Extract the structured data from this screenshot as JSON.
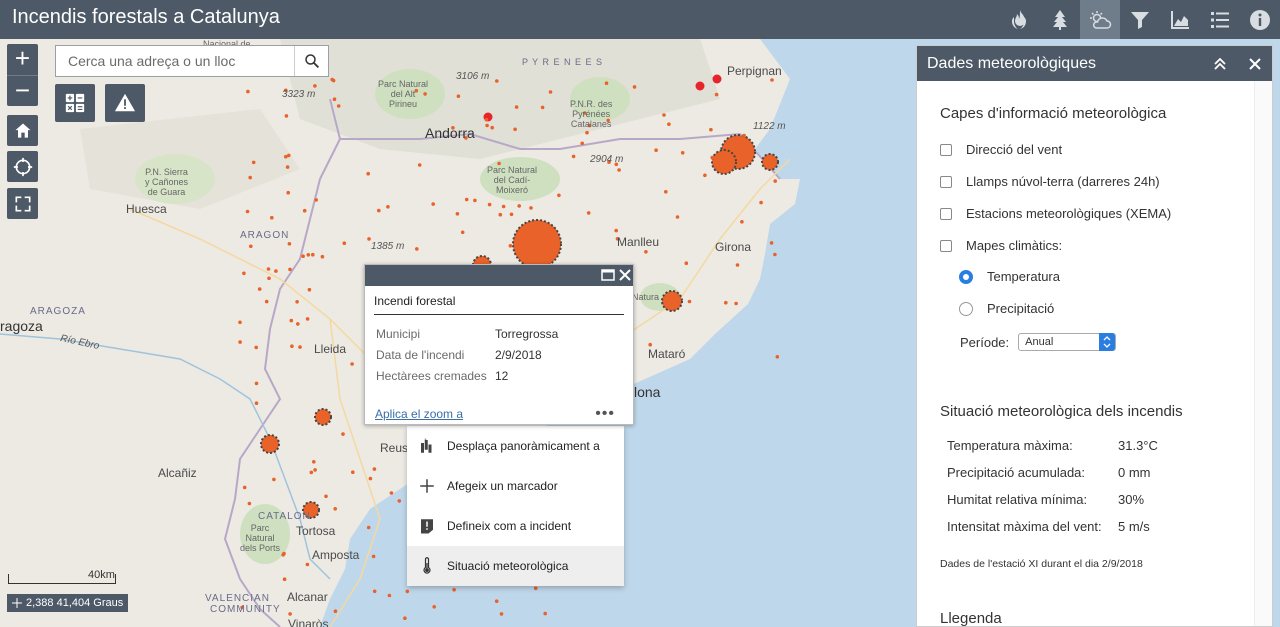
{
  "app": {
    "title": "Incendis forestals a Catalunya"
  },
  "toolbar": {
    "items": [
      {
        "icon": "fire-icon"
      },
      {
        "icon": "tree-icon"
      },
      {
        "icon": "weather-icon",
        "active": true
      },
      {
        "icon": "filter-icon"
      },
      {
        "icon": "chart-icon"
      },
      {
        "icon": "list-icon"
      },
      {
        "icon": "info-icon"
      }
    ]
  },
  "search": {
    "placeholder": "Cerca una adreça o un lloc"
  },
  "map": {
    "labels": {
      "andorra": "Andorra",
      "perpignan": "Perpignan",
      "huesca": "Huesca",
      "aragon": "ARAGON",
      "aragoza": "ragoza",
      "aragoza2": "ARAGOZA",
      "rio_ebro": "Río Ebro",
      "lleida": "Lleida",
      "manlleu": "Manlleu",
      "girona": "Girona",
      "mataro": "Mataró",
      "barcelona": "lona",
      "reus": "Reus",
      "alcaniz": "Alcañiz",
      "tortosa": "Tortosa",
      "amposta": "Amposta",
      "alcanar": "Alcanar",
      "vinaros": "Vinaròs",
      "valencian": "VALENCIAN",
      "community": "COMMUNITY",
      "pyrenees": "P Y R E N E E S",
      "parc_alt_pirineu": "Parc Natural\ndel Alt\nPirineu",
      "parc_cadi": "Parc Natural\ndel Cadí-\nMoixeró",
      "pnr_pyrenees": "P.N.R. des\nPyrénées\nCatalanes",
      "pn_sierra": "P.N. Sierra\ny Cañones\nde Guara",
      "parc_ports": "Parc\nNatural\ndels Ports",
      "natura": "Natura",
      "catalonia": "CATALON",
      "nacional": "Nacional de",
      "elev_3106": "3106 m",
      "elev_3323": "3323 m",
      "elev_2904": "2904 m",
      "elev_1122": "1122 m",
      "elev_1385": "1385 m"
    }
  },
  "popup": {
    "title": "Incendi forestal",
    "rows": [
      {
        "key": "Municipi",
        "value": "Torregrossa"
      },
      {
        "key": "Data de l'incendi",
        "value": "2/9/2018"
      },
      {
        "key": "Hectàrees cremades",
        "value": "12"
      }
    ],
    "zoom_link": "Aplica el zoom a",
    "more": "•••"
  },
  "context_menu": {
    "items": [
      {
        "label": "Desplaça panoràmicament a",
        "icon": "pan-icon"
      },
      {
        "label": "Afegeix un marcador",
        "icon": "plus-icon"
      },
      {
        "label": "Defineix com a incident",
        "icon": "incident-icon"
      },
      {
        "label": "Situació meteorològica",
        "icon": "thermometer-icon"
      }
    ]
  },
  "scale": {
    "label": "40km"
  },
  "coords": {
    "text": "2,388 41,404 Graus"
  },
  "panel": {
    "title": "Dades meteorològiques",
    "layers_heading": "Capes d'informació meteorològica",
    "layers": [
      "Direcció del vent",
      "Llamps núvol-terra (darreres 24h)",
      "Estacions meteorològiques (XEMA)",
      "Mapes climàtics:"
    ],
    "climate_options": [
      {
        "label": "Temperatura",
        "selected": true
      },
      {
        "label": "Precipitació",
        "selected": false
      }
    ],
    "period_label": "Període:",
    "period_value": "Anual",
    "situation_heading": "Situació meteorològica dels incendis",
    "stats": [
      {
        "key": "Temperatura màxima:",
        "value": "31.3°C"
      },
      {
        "key": "Precipitació acumulada:",
        "value": "0 mm"
      },
      {
        "key": "Humitat relativa mínima:",
        "value": "30%"
      },
      {
        "key": "Intensitat màxima del vent:",
        "value": "5 m/s"
      }
    ],
    "note": "Dades de l'estació XI durant el dia 2/9/2018",
    "legend_heading": "Llegenda"
  },
  "colors": {
    "header": "#4d5966",
    "fire_point": "#e8622a",
    "station_point": "#e5252a",
    "accent": "#2a7de1"
  }
}
